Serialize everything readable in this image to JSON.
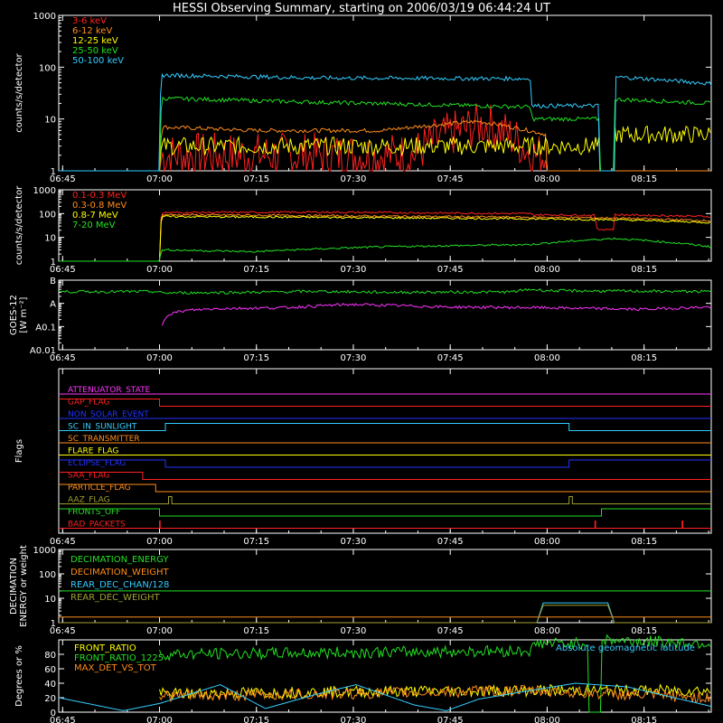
{
  "title": "HESSI Observing Summary, starting on 2006/03/19 06:44:24 UT",
  "colors": {
    "background": "#000000",
    "axes": "#ffffff",
    "red": "#ff2020",
    "orange": "#ff8c1a",
    "yellow": "#ffff00",
    "green": "#22e022",
    "cyan": "#33ccff",
    "magenta": "#ff33ff",
    "blue": "#2233ff",
    "olive": "#a0a030"
  },
  "time_ticks": [
    "06:45",
    "07:00",
    "07:15",
    "07:30",
    "07:45",
    "08:00",
    "08:15"
  ],
  "time_tick_minutes": [
    0.6,
    15.6,
    30.6,
    45.6,
    60.6,
    75.6,
    90.6
  ],
  "xlim_minutes": [
    0,
    101
  ],
  "chart_data": [
    {
      "id": "hxr",
      "type": "line",
      "ylabel": "counts/s/detector",
      "yscale": "log",
      "ylim": [
        1,
        1000
      ],
      "yticks": [
        "1",
        "10",
        "100",
        "1000"
      ],
      "ytick_values": [
        1,
        10,
        100,
        1000
      ],
      "legend_position": "top-left",
      "series": [
        {
          "name": "3-6 keV",
          "color": "red",
          "points": [
            [
              15.6,
              1
            ],
            [
              16,
              2
            ],
            [
              30,
              2
            ],
            [
              55,
              2
            ],
            [
              66,
              8
            ],
            [
              73,
              2
            ],
            [
              75.5,
              2
            ],
            [
              75.6,
              1
            ],
            [
              101,
              1
            ]
          ]
        },
        {
          "name": "6-12 keV",
          "color": "orange",
          "points": [
            [
              15.6,
              1
            ],
            [
              16,
              7
            ],
            [
              30,
              6
            ],
            [
              50,
              6
            ],
            [
              65,
              9
            ],
            [
              70,
              7
            ],
            [
              75.5,
              5
            ],
            [
              75.6,
              1
            ],
            [
              101,
              1
            ]
          ]
        },
        {
          "name": "12-25 keV",
          "color": "yellow",
          "points": [
            [
              15.6,
              1
            ],
            [
              16,
              3
            ],
            [
              40,
              3
            ],
            [
              75.5,
              3
            ],
            [
              75.6,
              3
            ],
            [
              83.6,
              3
            ],
            [
              83.7,
              1
            ],
            [
              86,
              1
            ],
            [
              86.1,
              5
            ],
            [
              101,
              5
            ]
          ]
        },
        {
          "name": "25-50 keV",
          "color": "green",
          "points": [
            [
              15.6,
              1
            ],
            [
              16,
              25
            ],
            [
              40,
              21
            ],
            [
              73,
              17
            ],
            [
              73.2,
              10
            ],
            [
              83.6,
              10
            ],
            [
              83.7,
              1
            ],
            [
              86,
              1
            ],
            [
              86.1,
              24
            ],
            [
              101,
              20
            ]
          ]
        },
        {
          "name": "50-100 keV",
          "color": "cyan",
          "points": [
            [
              0,
              1
            ],
            [
              15.6,
              1
            ],
            [
              16,
              70
            ],
            [
              40,
              62
            ],
            [
              73,
              60
            ],
            [
              73.2,
              18
            ],
            [
              83.6,
              18
            ],
            [
              83.7,
              1
            ],
            [
              86,
              1
            ],
            [
              86.1,
              65
            ],
            [
              101,
              48
            ]
          ]
        }
      ]
    },
    {
      "id": "gamma",
      "type": "line",
      "ylabel": "counts/s/detector",
      "yscale": "log",
      "ylim": [
        1,
        1000
      ],
      "yticks": [
        "1",
        "10",
        "100",
        "1000"
      ],
      "ytick_values": [
        1,
        10,
        100,
        1000
      ],
      "legend_position": "top-left",
      "series": [
        {
          "name": "0.1-0.3 MeV",
          "color": "red",
          "points": [
            [
              15.6,
              1
            ],
            [
              16,
              110
            ],
            [
              40,
              115
            ],
            [
              73,
              100
            ],
            [
              73.2,
              90
            ],
            [
              83,
              85
            ],
            [
              83.2,
              22
            ],
            [
              86,
              22
            ],
            [
              86.1,
              90
            ],
            [
              101,
              75
            ]
          ]
        },
        {
          "name": "0.3-0.8 MeV",
          "color": "orange",
          "points": [
            [
              15.6,
              1
            ],
            [
              16,
              90
            ],
            [
              40,
              82
            ],
            [
              73,
              70
            ],
            [
              86,
              65
            ],
            [
              101,
              50
            ]
          ]
        },
        {
          "name": "0.8-7 MeV",
          "color": "yellow",
          "points": [
            [
              15.6,
              1
            ],
            [
              16,
              75
            ],
            [
              40,
              70
            ],
            [
              73,
              60
            ],
            [
              86,
              55
            ],
            [
              101,
              42
            ]
          ]
        },
        {
          "name": "7-20 MeV",
          "color": "green",
          "points": [
            [
              0,
              1
            ],
            [
              15.6,
              1
            ],
            [
              16,
              3
            ],
            [
              30,
              2.5
            ],
            [
              50,
              4
            ],
            [
              73,
              5
            ],
            [
              86,
              9
            ],
            [
              101,
              4
            ]
          ]
        }
      ]
    },
    {
      "id": "goes",
      "type": "line",
      "ylabel": "GOES-12 [W m-2]",
      "ylabel_lines": [
        "GOES-12",
        "[W m⁻²]"
      ],
      "yscale": "log",
      "ylim": [
        0.01,
        10
      ],
      "yticks": [
        "A0.01",
        "A0.1",
        "A",
        "B"
      ],
      "ytick_values": [
        0.01,
        0.1,
        1,
        10
      ],
      "series": [
        {
          "name": "long",
          "color": "green",
          "points": [
            [
              0,
              3.2
            ],
            [
              15,
              3.2
            ],
            [
              16,
              2.8
            ],
            [
              30,
              3.0
            ],
            [
              40,
              3.3
            ],
            [
              50,
              3.0
            ],
            [
              70,
              3.1
            ],
            [
              73,
              4.0
            ],
            [
              76,
              3.5
            ],
            [
              101,
              3.2
            ]
          ]
        },
        {
          "name": "short",
          "color": "magenta",
          "points": [
            [
              16,
              0.12
            ],
            [
              17,
              0.35
            ],
            [
              20,
              0.5
            ],
            [
              25,
              0.6
            ],
            [
              35,
              0.65
            ],
            [
              45,
              0.9
            ],
            [
              60,
              0.7
            ],
            [
              75,
              0.65
            ],
            [
              90,
              0.55
            ],
            [
              101,
              0.7
            ]
          ]
        }
      ]
    },
    {
      "id": "flags",
      "type": "line",
      "ylabel": "Flags",
      "flags": [
        {
          "name": "ATTENUATOR_STATE",
          "color": "magenta",
          "segments": [
            [
              0,
              0
            ],
            [
              101,
              0
            ]
          ]
        },
        {
          "name": "SAA_FLAG_GAP",
          "label": "GAP_FLAG",
          "color": "red",
          "segments": [
            [
              0,
              1
            ],
            [
              15.6,
              1
            ],
            [
              15.6,
              0
            ],
            [
              101,
              0
            ]
          ]
        },
        {
          "name": "NON_SOLAR_EVENT",
          "color": "blue",
          "segments": [
            [
              0,
              0
            ],
            [
              101,
              0
            ]
          ]
        },
        {
          "name": "SC_IN_SUNLIGHT",
          "color": "cyan",
          "segments": [
            [
              0,
              0
            ],
            [
              16.5,
              0
            ],
            [
              16.5,
              1
            ],
            [
              79,
              1
            ],
            [
              79,
              0
            ],
            [
              101,
              0
            ]
          ]
        },
        {
          "name": "SC_TRANSMITTER",
          "color": "orange",
          "segments": [
            [
              0,
              0
            ],
            [
              101,
              0
            ]
          ]
        },
        {
          "name": "FLARE_FLAG",
          "color": "yellow",
          "segments": [
            [
              0,
              0
            ],
            [
              101,
              0
            ]
          ]
        },
        {
          "name": "ECLIPSE_FLAG",
          "color": "blue",
          "segments": [
            [
              0,
              1
            ],
            [
              16.5,
              1
            ],
            [
              16.5,
              0
            ],
            [
              79,
              0
            ],
            [
              79,
              1
            ],
            [
              101,
              1
            ]
          ]
        },
        {
          "name": "SAA_FLAG",
          "color": "red",
          "segments": [
            [
              0,
              1
            ],
            [
              13,
              1
            ],
            [
              13,
              0
            ],
            [
              101,
              0
            ]
          ]
        },
        {
          "name": "PARTICLE_FLAG",
          "color": "orange",
          "segments": [
            [
              0,
              1
            ],
            [
              15,
              1
            ],
            [
              15,
              0
            ],
            [
              101,
              0
            ]
          ]
        },
        {
          "name": "AAZ_FLAG",
          "color": "olive",
          "segments": [
            [
              0,
              0
            ],
            [
              17,
              0
            ],
            [
              17,
              1
            ],
            [
              17.5,
              1
            ],
            [
              17.5,
              0
            ],
            [
              79,
              0
            ],
            [
              79,
              1
            ],
            [
              79.5,
              1
            ],
            [
              79.5,
              0
            ],
            [
              101,
              0
            ]
          ]
        },
        {
          "name": "FRONTS_OFF",
          "color": "green",
          "segments": [
            [
              0,
              1
            ],
            [
              15.6,
              1
            ],
            [
              15.6,
              0
            ],
            [
              84,
              0
            ],
            [
              84,
              1
            ],
            [
              101,
              1
            ]
          ]
        },
        {
          "name": "BAD_PACKETS",
          "color": "red",
          "segments": [
            [
              0,
              0
            ],
            [
              15.6,
              0
            ],
            [
              15.6,
              1
            ],
            [
              15.7,
              1
            ],
            [
              15.7,
              0
            ],
            [
              83,
              0
            ],
            [
              83,
              1
            ],
            [
              83.1,
              1
            ],
            [
              83.1,
              0
            ],
            [
              96.5,
              0
            ],
            [
              96.5,
              1
            ],
            [
              96.6,
              1
            ],
            [
              96.6,
              0
            ],
            [
              101,
              0
            ]
          ]
        }
      ]
    },
    {
      "id": "decimation",
      "type": "line",
      "ylabel": "DECIMATION ENERGY or weight",
      "ylabel_lines": [
        "DECIMATION",
        "ENERGY or weight"
      ],
      "yscale": "log",
      "ylim": [
        1,
        1000
      ],
      "yticks": [
        "1",
        "10",
        "100",
        "1000"
      ],
      "ytick_values": [
        1,
        10,
        100,
        1000
      ],
      "legend_position": "top-left",
      "series": [
        {
          "name": "DECIMATION_ENERGY",
          "color": "green",
          "points": [
            [
              0,
              20
            ],
            [
              101,
              20
            ]
          ]
        },
        {
          "name": "DECIMATION_WEIGHT",
          "color": "orange",
          "points": [
            [
              0,
              1.7
            ],
            [
              101,
              1.7
            ]
          ]
        },
        {
          "name": "REAR_DEC_CHAN/128",
          "color": "cyan",
          "points": [
            [
              0,
              1
            ],
            [
              74,
              1
            ],
            [
              74,
              6.5
            ],
            [
              85,
              6.5
            ],
            [
              85,
              1
            ],
            [
              101,
              1
            ]
          ]
        },
        {
          "name": "REAR_DEC_WEIGHT",
          "color": "olive",
          "points": [
            [
              0,
              1
            ],
            [
              74,
              1
            ],
            [
              74,
              5.2
            ],
            [
              85,
              5.2
            ],
            [
              85,
              1
            ],
            [
              101,
              1
            ]
          ]
        }
      ]
    },
    {
      "id": "ratio",
      "type": "line",
      "ylabel": "Degrees or %",
      "ylim": [
        0,
        100
      ],
      "yticks": [
        "0",
        "20",
        "40",
        "60",
        "80"
      ],
      "ytick_values": [
        0,
        20,
        40,
        60,
        80
      ],
      "legend_position": "top-left",
      "annotation": "Absolute geomagnetic latitude",
      "series": [
        {
          "name": "FRONT_RATIO",
          "color": "yellow",
          "points": [
            [
              15.6,
              25
            ],
            [
              40,
              28
            ],
            [
              73,
              30
            ],
            [
              101,
              30
            ]
          ]
        },
        {
          "name": "FRONT_RATIO_1225",
          "color": "green",
          "points": [
            [
              15.6,
              80
            ],
            [
              40,
              82
            ],
            [
              73,
              85
            ],
            [
              74,
              95
            ],
            [
              82,
              95
            ],
            [
              82,
              0
            ],
            [
              84,
              0
            ],
            [
              84,
              100
            ],
            [
              101,
              95
            ]
          ]
        },
        {
          "name": "MAX_DET_VS_TOT",
          "color": "orange",
          "points": [
            [
              15.6,
              22
            ],
            [
              40,
              25
            ],
            [
              73,
              30
            ],
            [
              86,
              25
            ],
            [
              101,
              20
            ]
          ]
        },
        {
          "name": "Absolute geomagnetic latitude",
          "color": "cyan",
          "points": [
            [
              0,
              20
            ],
            [
              10,
              2
            ],
            [
              15.6,
              12
            ],
            [
              25,
              38
            ],
            [
              32,
              5
            ],
            [
              40,
              25
            ],
            [
              46,
              38
            ],
            [
              55,
              10
            ],
            [
              60,
              2
            ],
            [
              65,
              18
            ],
            [
              73,
              30
            ],
            [
              80,
              40
            ],
            [
              88,
              35
            ],
            [
              101,
              8
            ]
          ]
        }
      ]
    }
  ]
}
